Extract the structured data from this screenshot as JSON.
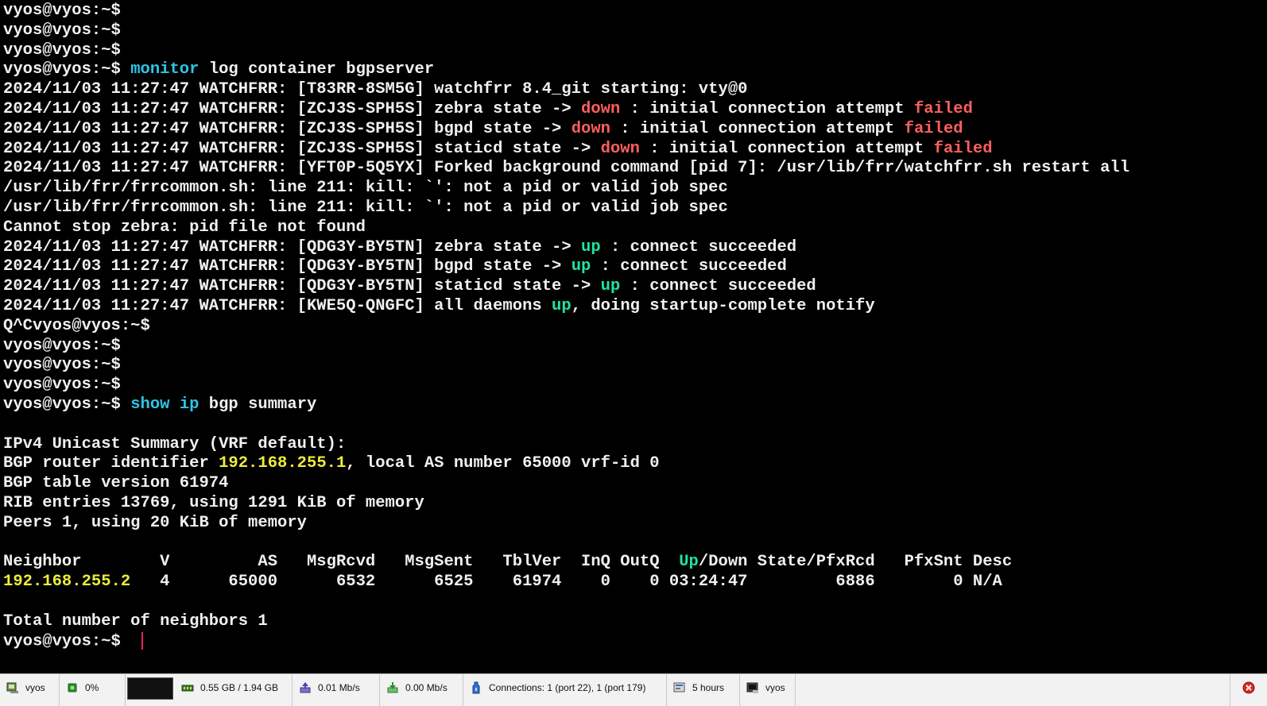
{
  "terminal": {
    "lines": [
      [
        {
          "t": "vyos@vyos:~$",
          "c": "white"
        }
      ],
      [
        {
          "t": "vyos@vyos:~$",
          "c": "white"
        }
      ],
      [
        {
          "t": "vyos@vyos:~$",
          "c": "white"
        }
      ],
      [
        {
          "t": "vyos@vyos:~$ ",
          "c": "white"
        },
        {
          "t": "monitor",
          "c": "cyan"
        },
        {
          "t": " log container bgpserver",
          "c": "white"
        }
      ],
      [
        {
          "t": "2024/11/03 11:27:47 WATCHFRR: [T83RR-8SM5G] watchfrr 8.4_git starting: vty@0",
          "c": "white"
        }
      ],
      [
        {
          "t": "2024/11/03 11:27:47 WATCHFRR: [ZCJ3S-SPH5S] zebra state -> ",
          "c": "white"
        },
        {
          "t": "down",
          "c": "red"
        },
        {
          "t": " : initial connection attempt ",
          "c": "white"
        },
        {
          "t": "failed",
          "c": "red"
        }
      ],
      [
        {
          "t": "2024/11/03 11:27:47 WATCHFRR: [ZCJ3S-SPH5S] bgpd state -> ",
          "c": "white"
        },
        {
          "t": "down",
          "c": "red"
        },
        {
          "t": " : initial connection attempt ",
          "c": "white"
        },
        {
          "t": "failed",
          "c": "red"
        }
      ],
      [
        {
          "t": "2024/11/03 11:27:47 WATCHFRR: [ZCJ3S-SPH5S] staticd state -> ",
          "c": "white"
        },
        {
          "t": "down",
          "c": "red"
        },
        {
          "t": " : initial connection attempt ",
          "c": "white"
        },
        {
          "t": "failed",
          "c": "red"
        }
      ],
      [
        {
          "t": "2024/11/03 11:27:47 WATCHFRR: [YFT0P-5Q5YX] Forked background command [pid 7]: /usr/lib/frr/watchfrr.sh restart all",
          "c": "white"
        }
      ],
      [
        {
          "t": "/usr/lib/frr/frrcommon.sh: line 211: kill: `': not a pid or valid job spec",
          "c": "white"
        }
      ],
      [
        {
          "t": "/usr/lib/frr/frrcommon.sh: line 211: kill: `': not a pid or valid job spec",
          "c": "white"
        }
      ],
      [
        {
          "t": "Cannot stop zebra: pid file not found",
          "c": "white"
        }
      ],
      [
        {
          "t": "2024/11/03 11:27:47 WATCHFRR: [QDG3Y-BY5TN] zebra state -> ",
          "c": "white"
        },
        {
          "t": "up",
          "c": "green"
        },
        {
          "t": " : connect succeeded",
          "c": "white"
        }
      ],
      [
        {
          "t": "2024/11/03 11:27:47 WATCHFRR: [QDG3Y-BY5TN] bgpd state -> ",
          "c": "white"
        },
        {
          "t": "up",
          "c": "green"
        },
        {
          "t": " : connect succeeded",
          "c": "white"
        }
      ],
      [
        {
          "t": "2024/11/03 11:27:47 WATCHFRR: [QDG3Y-BY5TN] staticd state -> ",
          "c": "white"
        },
        {
          "t": "up",
          "c": "green"
        },
        {
          "t": " : connect succeeded",
          "c": "white"
        }
      ],
      [
        {
          "t": "2024/11/03 11:27:47 WATCHFRR: [KWE5Q-QNGFC] all daemons ",
          "c": "white"
        },
        {
          "t": "up",
          "c": "green"
        },
        {
          "t": ", doing startup-complete notify",
          "c": "white"
        }
      ],
      [
        {
          "t": "Q^Cvyos@vyos:~$",
          "c": "white"
        }
      ],
      [
        {
          "t": "vyos@vyos:~$",
          "c": "white"
        }
      ],
      [
        {
          "t": "vyos@vyos:~$",
          "c": "white"
        }
      ],
      [
        {
          "t": "vyos@vyos:~$",
          "c": "white"
        }
      ],
      [
        {
          "t": "vyos@vyos:~$ ",
          "c": "white"
        },
        {
          "t": "show",
          "c": "cyan"
        },
        {
          "t": " ",
          "c": "white"
        },
        {
          "t": "ip",
          "c": "cyan"
        },
        {
          "t": " bgp summary",
          "c": "white"
        }
      ],
      [],
      [
        {
          "t": "IPv4 Unicast Summary (VRF default):",
          "c": "white"
        }
      ],
      [
        {
          "t": "BGP router identifier ",
          "c": "white"
        },
        {
          "t": "192.168.255.1",
          "c": "yellow"
        },
        {
          "t": ", local AS number 65000 vrf-id 0",
          "c": "white"
        }
      ],
      [
        {
          "t": "BGP table version 61974",
          "c": "white"
        }
      ],
      [
        {
          "t": "RIB entries 13769, using 1291 KiB of memory",
          "c": "white"
        }
      ],
      [
        {
          "t": "Peers 1, using 20 KiB of memory",
          "c": "white"
        }
      ],
      [],
      [
        {
          "t": "Neighbor        V         AS   MsgRcvd   MsgSent   TblVer  InQ OutQ  ",
          "c": "white"
        },
        {
          "t": "Up",
          "c": "green"
        },
        {
          "t": "/Down State/PfxRcd   PfxSnt Desc",
          "c": "white"
        }
      ],
      [
        {
          "t": "192.168.255.2",
          "c": "yellow"
        },
        {
          "t": "   4      65000      6532      6525    61974    0    0 03:24:47         6886        0 N/A",
          "c": "white"
        }
      ],
      [],
      [
        {
          "t": "Total number of neighbors 1",
          "c": "white"
        }
      ],
      [
        {
          "t": "vyos@vyos:~$ ",
          "c": "white"
        }
      ]
    ]
  },
  "statusbar": {
    "host": "vyos",
    "cpu": "0%",
    "memory": "0.55 GB / 1.94 GB",
    "upload": "0.01 Mb/s",
    "download": "0.00 Mb/s",
    "connections": "Connections: 1 (port 22), 1 (port 179)",
    "uptime": "5 hours",
    "session": "vyos"
  }
}
